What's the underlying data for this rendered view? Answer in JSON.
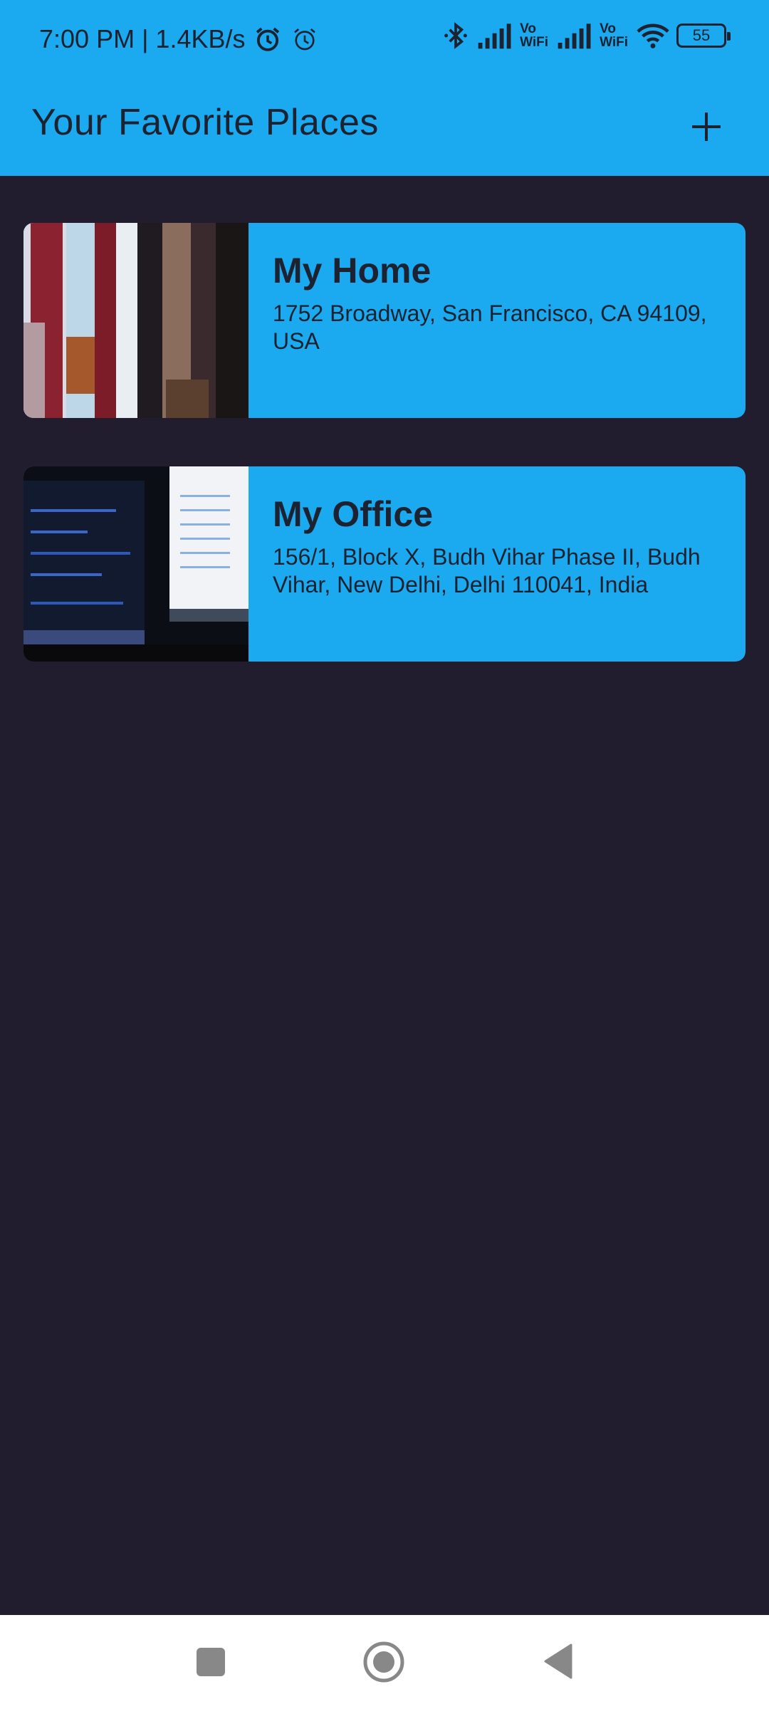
{
  "status_bar": {
    "time_speed": "7:00 PM | 1.4KB/s",
    "vowifi_1": "Vo\nWiFi",
    "vowifi_2": "Vo\nWiFi",
    "battery": "55"
  },
  "app_bar": {
    "title": "Your Favorite Places",
    "add_icon": "plus-icon"
  },
  "places": [
    {
      "title": "My Home",
      "address": "1752 Broadway, San Francisco, CA 94109, USA"
    },
    {
      "title": "My Office",
      "address": "156/1, Block X, Budh Vihar Phase II, Budh Vihar, New Delhi, Delhi 110041, India"
    }
  ],
  "nav_bar": {
    "recents_icon": "square-icon",
    "home_icon": "circle-home-icon",
    "back_icon": "triangle-back-icon"
  },
  "colors": {
    "accent": "#1ba9ef",
    "background": "#211c2e",
    "text_dark": "#1c2230"
  }
}
